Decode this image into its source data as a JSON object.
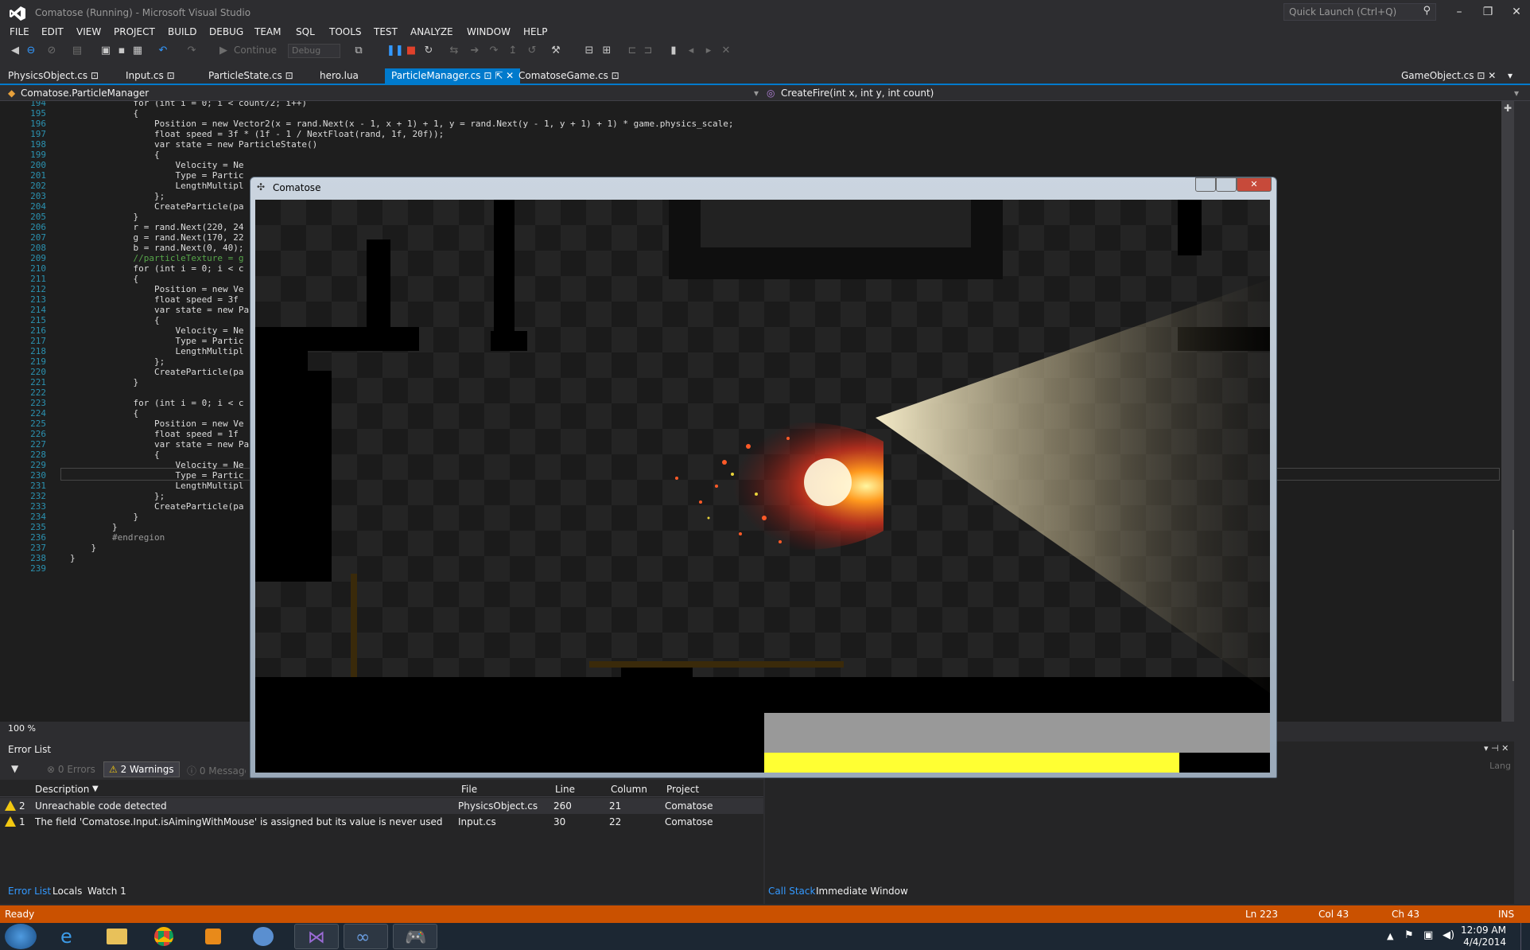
{
  "window": {
    "title": "Comatose (Running) - Microsoft Visual Studio",
    "quick_launch_placeholder": "Quick Launch (Ctrl+Q)"
  },
  "menu": [
    "FILE",
    "EDIT",
    "VIEW",
    "PROJECT",
    "BUILD",
    "DEBUG",
    "TEAM",
    "SQL",
    "TOOLS",
    "TEST",
    "ANALYZE",
    "WINDOW",
    "HELP"
  ],
  "toolbar": {
    "continue_label": "Continue",
    "configuration": "Debug"
  },
  "tabs": [
    {
      "label": "PhysicsObject.cs",
      "active": false
    },
    {
      "label": "Input.cs",
      "active": false
    },
    {
      "label": "ParticleState.cs",
      "active": false
    },
    {
      "label": "hero.lua",
      "active": false
    },
    {
      "label": "ParticleManager.cs",
      "active": true
    },
    {
      "label": "ComatoseGame.cs",
      "active": false
    },
    {
      "label": "GameObject.cs",
      "active": false
    }
  ],
  "navbar": {
    "class": "Comatose.ParticleManager",
    "member": "CreateFire(int x, int y, int count)"
  },
  "code_lines": [
    {
      "n": "194",
      "text": "            for (int i = 0; i < count/2; i++)"
    },
    {
      "n": "195",
      "text": "            {"
    },
    {
      "n": "196",
      "text": "                Position = new Vector2(x = rand.Next(x - 1, x + 1) + 1, y = rand.Next(y - 1, y + 1) + 1) * game.physics_scale;"
    },
    {
      "n": "197",
      "text": "                float speed = 3f * (1f - 1 / NextFloat(rand, 1f, 20f));"
    },
    {
      "n": "198",
      "text": "                var state = new ParticleState()"
    },
    {
      "n": "199",
      "text": "                {"
    },
    {
      "n": "200",
      "text": "                    Velocity = Ne"
    },
    {
      "n": "201",
      "text": "                    Type = Partic"
    },
    {
      "n": "202",
      "text": "                    LengthMultipl"
    },
    {
      "n": "203",
      "text": "                };"
    },
    {
      "n": "204",
      "text": "                CreateParticle(pa"
    },
    {
      "n": "205",
      "text": "            }"
    },
    {
      "n": "206",
      "text": "            r = rand.Next(220, 24"
    },
    {
      "n": "207",
      "text": "            g = rand.Next(170, 22"
    },
    {
      "n": "208",
      "text": "            b = rand.Next(0, 40);"
    },
    {
      "n": "209",
      "text": "            //particleTexture = g"
    },
    {
      "n": "210",
      "text": "            for (int i = 0; i < c"
    },
    {
      "n": "211",
      "text": "            {"
    },
    {
      "n": "212",
      "text": "                Position = new Ve"
    },
    {
      "n": "213",
      "text": "                float speed = 3f"
    },
    {
      "n": "214",
      "text": "                var state = new Pa"
    },
    {
      "n": "215",
      "text": "                {"
    },
    {
      "n": "216",
      "text": "                    Velocity = Ne"
    },
    {
      "n": "217",
      "text": "                    Type = Partic"
    },
    {
      "n": "218",
      "text": "                    LengthMultipl"
    },
    {
      "n": "219",
      "text": "                };"
    },
    {
      "n": "220",
      "text": "                CreateParticle(pa"
    },
    {
      "n": "221",
      "text": "            }"
    },
    {
      "n": "222",
      "text": ""
    },
    {
      "n": "223",
      "text": "            for (int i = 0; i < c"
    },
    {
      "n": "224",
      "text": "            {"
    },
    {
      "n": "225",
      "text": "                Position = new Ve"
    },
    {
      "n": "226",
      "text": "                float speed = 1f"
    },
    {
      "n": "227",
      "text": "                var state = new Pa"
    },
    {
      "n": "228",
      "text": "                {"
    },
    {
      "n": "229",
      "text": "                    Velocity = Ne"
    },
    {
      "n": "230",
      "text": "                    Type = Partic"
    },
    {
      "n": "231",
      "text": "                    LengthMultipl"
    },
    {
      "n": "232",
      "text": "                };"
    },
    {
      "n": "233",
      "text": "                CreateParticle(pa"
    },
    {
      "n": "234",
      "text": "            }"
    },
    {
      "n": "235",
      "text": "        }"
    },
    {
      "n": "236",
      "text": "        #endregion"
    },
    {
      "n": "237",
      "text": "    }"
    },
    {
      "n": "238",
      "text": "}"
    },
    {
      "n": "239",
      "text": ""
    }
  ],
  "editor": {
    "zoom": "100 %"
  },
  "game_window": {
    "title": "Comatose",
    "health_fraction": 0.82
  },
  "error_list": {
    "title": "Error List",
    "errors_label": "0 Errors",
    "warnings_label": "2 Warnings",
    "messages_label": "0 Messages",
    "columns": [
      "Description",
      "File",
      "Line",
      "Column",
      "Project"
    ],
    "rows": [
      {
        "num": "2",
        "description": "Unreachable code detected",
        "file": "PhysicsObject.cs",
        "line": "260",
        "column": "21",
        "project": "Comatose"
      },
      {
        "num": "1",
        "description": "The field 'Comatose.Input.isAimingWithMouse' is assigned but its value is never used",
        "file": "Input.cs",
        "line": "30",
        "column": "22",
        "project": "Comatose"
      }
    ]
  },
  "bottom_tabs_left": [
    "Error List",
    "Locals",
    "Watch 1"
  ],
  "bottom_tabs_right": [
    "Call Stack",
    "Immediate Window"
  ],
  "right_pane_partial": "Lang",
  "statusbar": {
    "state": "Ready",
    "ln": "Ln 223",
    "col": "Col 43",
    "ch": "Ch 43",
    "mode": "INS"
  },
  "taskbar": {
    "time": "12:09 AM",
    "date": "4/4/2014"
  },
  "colors": {
    "accent": "#007acc",
    "status_bar": "#ca5100",
    "warning": "#f2c811",
    "health_bar": "#ffff33"
  }
}
